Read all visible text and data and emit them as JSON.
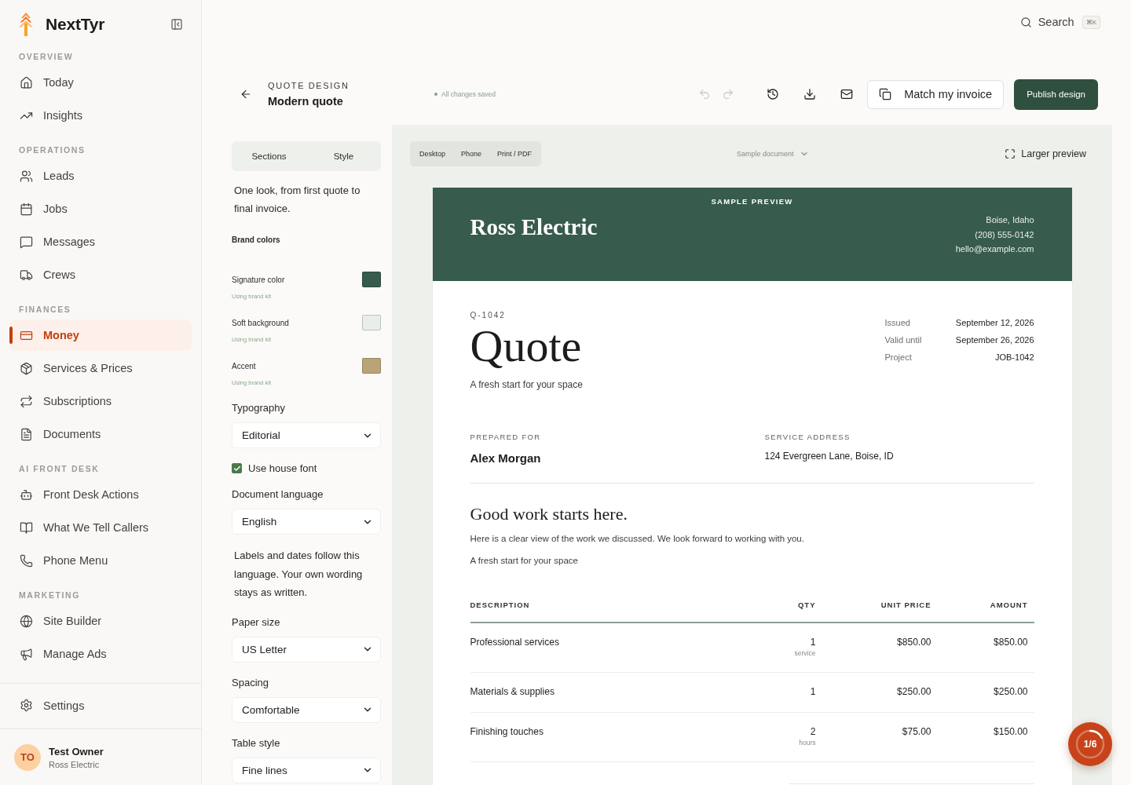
{
  "sidebar": {
    "brand": "NextTyr",
    "sections": [
      {
        "heading": "OVERVIEW",
        "items": [
          {
            "label": "Today",
            "selected": false
          },
          {
            "label": "Insights",
            "selected": false
          }
        ]
      },
      {
        "heading": "OPERATIONS",
        "items": [
          {
            "label": "Leads",
            "selected": false
          },
          {
            "label": "Jobs",
            "selected": false
          },
          {
            "label": "Messages",
            "selected": false
          },
          {
            "label": "Crews",
            "selected": false
          }
        ]
      },
      {
        "heading": "FINANCES",
        "items": [
          {
            "label": "Money",
            "selected": true
          },
          {
            "label": "Services & Prices",
            "selected": false
          },
          {
            "label": "Subscriptions",
            "selected": false
          },
          {
            "label": "Documents",
            "selected": false
          }
        ]
      },
      {
        "heading": "AI FRONT DESK",
        "items": [
          {
            "label": "Front Desk Actions",
            "selected": false
          },
          {
            "label": "What We Tell Callers",
            "selected": false
          },
          {
            "label": "Phone Menu",
            "selected": false
          }
        ]
      },
      {
        "heading": "MARKETING",
        "items": [
          {
            "label": "Site Builder",
            "selected": false
          },
          {
            "label": "Manage Ads",
            "selected": false
          }
        ]
      }
    ],
    "settings": "Settings",
    "user": {
      "initials": "TO",
      "name": "Test Owner",
      "company": "Ross Electric"
    }
  },
  "search": {
    "label": "Search",
    "shortcut": "⌘K"
  },
  "header": {
    "eyebrow": "QUOTE DESIGN",
    "title": "Modern quote",
    "save_status": "All changes saved",
    "actions": [
      {
        "disabled": true
      },
      {
        "disabled": true
      },
      {
        "disabled": false
      },
      {
        "disabled": false
      },
      {
        "disabled": false
      }
    ],
    "match_button": "Match my invoice",
    "publish_button": "Publish design"
  },
  "panel": {
    "tabs": [
      {
        "label": "Sections"
      },
      {
        "label": "Style"
      }
    ],
    "intro": "One look, from first quote to final invoice.",
    "brand_colors": {
      "heading": "Brand colors",
      "items": [
        {
          "label": "Signature color",
          "note": "Using brand kit",
          "color": "#375b4d"
        },
        {
          "label": "Soft background",
          "note": "Using brand kit",
          "color": "#e9eee9"
        },
        {
          "label": "Accent",
          "note": "Using brand kit",
          "color": "#b9a478"
        }
      ]
    },
    "controls": [
      {
        "kind": "select",
        "label": "Typography",
        "value": "Editorial"
      },
      {
        "kind": "checkbox",
        "label": "Use house font",
        "checked": true
      },
      {
        "kind": "select",
        "label": "Document language",
        "value": "English"
      },
      {
        "kind": "note",
        "text": "Labels and dates follow this language. Your own wording stays as written."
      },
      {
        "kind": "select",
        "label": "Paper size",
        "value": "US Letter"
      },
      {
        "kind": "select",
        "label": "Spacing",
        "value": "Comfortable"
      },
      {
        "kind": "select",
        "label": "Table style",
        "value": "Fine lines"
      }
    ]
  },
  "preview": {
    "devices": [
      {
        "label": "Desktop"
      },
      {
        "label": "Phone"
      },
      {
        "label": "Print / PDF"
      }
    ],
    "document_picker": "Sample document",
    "larger_preview": "Larger preview",
    "document": {
      "banner": {
        "label": "SAMPLE PREVIEW",
        "company": "Ross Electric",
        "contact": [
          "Boise, Idaho",
          "(208) 555-0142",
          "hello@example.com"
        ]
      },
      "number": "Q-1042",
      "title": "Quote",
      "subtitle": "A fresh start for your space",
      "meta": [
        {
          "label": "Issued",
          "value": "September 12, 2026"
        },
        {
          "label": "Valid until",
          "value": "September 26, 2026"
        },
        {
          "label": "Project",
          "value": "JOB-1042"
        }
      ],
      "prepared_for": {
        "label": "PREPARED FOR",
        "value": "Alex Morgan"
      },
      "service_address": {
        "label": "SERVICE ADDRESS",
        "value": "124 Evergreen Lane, Boise, ID"
      },
      "message": {
        "heading": "Good work starts here.",
        "body": "Here is a clear view of the work we discussed. We look forward to working with you.",
        "tagline": "A fresh start for your space"
      },
      "table": {
        "columns": [
          "DESCRIPTION",
          "QTY",
          "UNIT PRICE",
          "AMOUNT"
        ],
        "rows": [
          {
            "description": "Professional services",
            "qty": "1",
            "unit": "service",
            "unit_price": "$850.00",
            "amount": "$850.00"
          },
          {
            "description": "Materials & supplies",
            "qty": "1",
            "unit_price": "$250.00",
            "amount": "$250.00"
          },
          {
            "description": "Finishing touches",
            "qty": "2",
            "unit": "hours",
            "unit_price": "$75.00",
            "amount": "$150.00"
          }
        ]
      }
    }
  },
  "progress_badge": {
    "label": "1/6"
  }
}
